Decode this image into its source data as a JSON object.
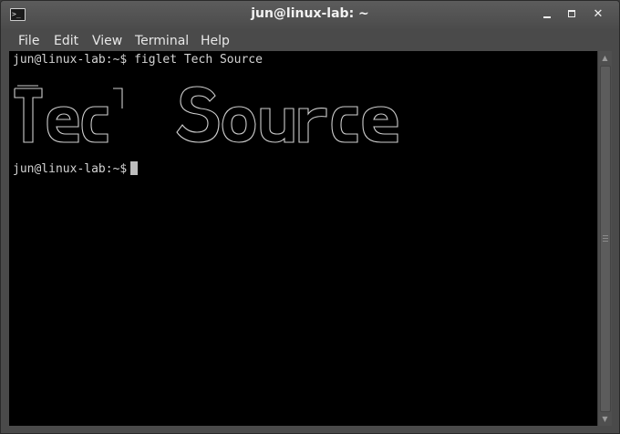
{
  "window": {
    "title": "jun@linux-lab: ~",
    "icon": "terminal-icon",
    "controls": [
      "minimize-icon",
      "maximize-icon",
      "close-icon"
    ]
  },
  "menubar": {
    "items": [
      {
        "label": "File"
      },
      {
        "label": "Edit"
      },
      {
        "label": "View"
      },
      {
        "label": "Terminal"
      },
      {
        "label": "Help"
      }
    ]
  },
  "terminal": {
    "prompt": "jun@linux-lab:~$",
    "command": "figlet Tech Source",
    "figlet_text": "Tech Source",
    "prompt2": "jun@linux-lab:~$",
    "foreground": "#d3d3d3",
    "background": "#000000"
  }
}
